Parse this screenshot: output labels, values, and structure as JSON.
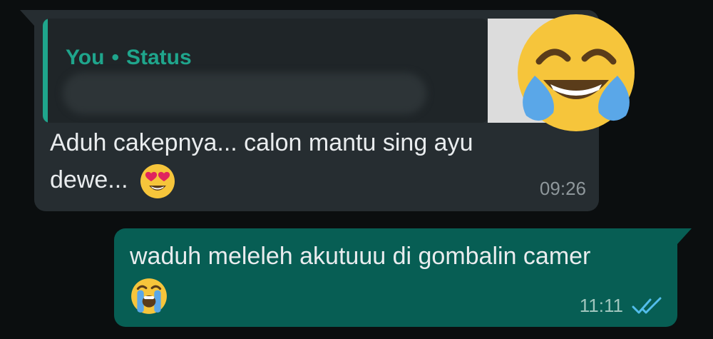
{
  "incoming_message": {
    "quote": {
      "sender": "You",
      "separator": "•",
      "type": "Status"
    },
    "text_line1": "Aduh cakepnya... calon mantu sing ayu",
    "text_line2": "dewe...",
    "inline_emoji": "heart-eyes-emoji",
    "time": "09:26",
    "thumbnail_emoji": "tears-of-joy-emoji"
  },
  "outgoing_message": {
    "text": "waduh meleleh akutuuu di gombalin camer",
    "emoji": "loudly-crying-emoji",
    "time": "11:11",
    "status_icon": "double-check-icon",
    "status_color": "#53bdeb"
  },
  "colors": {
    "background": "#0b0e0f",
    "incoming_bubble": "#262d31",
    "outgoing_bubble": "#075e54",
    "accent": "#1fa58c"
  }
}
